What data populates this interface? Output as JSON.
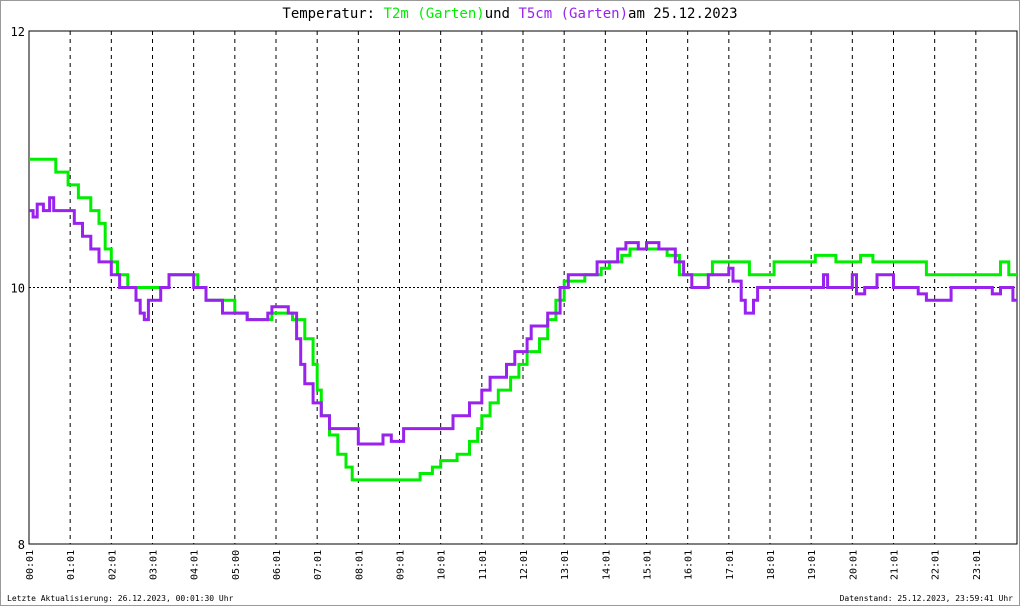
{
  "chart_data": {
    "type": "line",
    "title": {
      "prefix": "Temperatur:",
      "s1": "T2m (Garten)",
      "mid": "und",
      "s2": "T5cm (Garten)",
      "suffix": "am 25.12.2023"
    },
    "ylim": [
      8,
      12
    ],
    "yticks": [
      "8",
      "10",
      "12"
    ],
    "xticks": [
      "00:01",
      "01:01",
      "02:01",
      "03:01",
      "04:01",
      "05:00",
      "06:01",
      "07:01",
      "08:01",
      "09:01",
      "10:01",
      "11:01",
      "12:01",
      "13:01",
      "14:01",
      "15:01",
      "16:01",
      "17:01",
      "18:01",
      "19:01",
      "20:01",
      "21:01",
      "22:01",
      "23:01"
    ],
    "xunit": "hours",
    "series": [
      {
        "name": "T2m (Garten)",
        "color": "#00ee00",
        "points": [
          [
            0,
            11.0
          ],
          [
            0.65,
            10.9
          ],
          [
            0.95,
            10.8
          ],
          [
            1.2,
            10.7
          ],
          [
            1.5,
            10.6
          ],
          [
            1.7,
            10.5
          ],
          [
            1.85,
            10.3
          ],
          [
            2.0,
            10.2
          ],
          [
            2.15,
            10.1
          ],
          [
            2.4,
            10.0
          ],
          [
            3.4,
            10.1
          ],
          [
            4.1,
            10.0
          ],
          [
            4.3,
            9.9
          ],
          [
            5.0,
            9.8
          ],
          [
            5.3,
            9.75
          ],
          [
            5.9,
            9.8
          ],
          [
            6.4,
            9.75
          ],
          [
            6.7,
            9.6
          ],
          [
            6.9,
            9.4
          ],
          [
            7.0,
            9.2
          ],
          [
            7.1,
            9.0
          ],
          [
            7.3,
            8.85
          ],
          [
            7.5,
            8.7
          ],
          [
            7.7,
            8.6
          ],
          [
            7.85,
            8.5
          ],
          [
            9.5,
            8.55
          ],
          [
            9.8,
            8.6
          ],
          [
            10.0,
            8.65
          ],
          [
            10.4,
            8.7
          ],
          [
            10.7,
            8.8
          ],
          [
            10.9,
            8.9
          ],
          [
            11.0,
            9.0
          ],
          [
            11.2,
            9.1
          ],
          [
            11.4,
            9.2
          ],
          [
            11.7,
            9.3
          ],
          [
            11.9,
            9.4
          ],
          [
            12.1,
            9.5
          ],
          [
            12.4,
            9.6
          ],
          [
            12.6,
            9.75
          ],
          [
            12.8,
            9.9
          ],
          [
            13.0,
            10.05
          ],
          [
            13.5,
            10.1
          ],
          [
            13.9,
            10.15
          ],
          [
            14.1,
            10.2
          ],
          [
            14.4,
            10.25
          ],
          [
            14.6,
            10.3
          ],
          [
            15.5,
            10.25
          ],
          [
            15.8,
            10.1
          ],
          [
            16.6,
            10.2
          ],
          [
            17.5,
            10.1
          ],
          [
            18.1,
            10.2
          ],
          [
            19.1,
            10.25
          ],
          [
            19.6,
            10.2
          ],
          [
            20.2,
            10.25
          ],
          [
            20.5,
            10.2
          ],
          [
            21.8,
            10.1
          ],
          [
            23.6,
            10.2
          ],
          [
            23.8,
            10.1
          ],
          [
            24,
            10.1
          ]
        ]
      },
      {
        "name": "T5cm (Garten)",
        "color": "#9922ee",
        "points": [
          [
            0,
            10.6
          ],
          [
            0.1,
            10.55
          ],
          [
            0.2,
            10.65
          ],
          [
            0.35,
            10.6
          ],
          [
            0.5,
            10.7
          ],
          [
            0.6,
            10.6
          ],
          [
            0.95,
            10.6
          ],
          [
            1.1,
            10.5
          ],
          [
            1.3,
            10.4
          ],
          [
            1.5,
            10.3
          ],
          [
            1.7,
            10.2
          ],
          [
            2.0,
            10.1
          ],
          [
            2.2,
            10.0
          ],
          [
            2.6,
            9.9
          ],
          [
            2.7,
            9.8
          ],
          [
            2.8,
            9.75
          ],
          [
            2.9,
            9.9
          ],
          [
            3.2,
            10.0
          ],
          [
            3.4,
            10.1
          ],
          [
            4.0,
            10.0
          ],
          [
            4.3,
            9.9
          ],
          [
            4.7,
            9.8
          ],
          [
            5.3,
            9.75
          ],
          [
            5.8,
            9.8
          ],
          [
            5.9,
            9.85
          ],
          [
            6.3,
            9.8
          ],
          [
            6.5,
            9.6
          ],
          [
            6.6,
            9.4
          ],
          [
            6.7,
            9.25
          ],
          [
            6.9,
            9.1
          ],
          [
            7.1,
            9.0
          ],
          [
            7.3,
            8.9
          ],
          [
            8.0,
            8.78
          ],
          [
            8.6,
            8.85
          ],
          [
            8.8,
            8.8
          ],
          [
            9.1,
            8.9
          ],
          [
            10.3,
            9.0
          ],
          [
            10.7,
            9.1
          ],
          [
            11.0,
            9.2
          ],
          [
            11.2,
            9.3
          ],
          [
            11.6,
            9.4
          ],
          [
            11.8,
            9.5
          ],
          [
            12.1,
            9.6
          ],
          [
            12.2,
            9.7
          ],
          [
            12.6,
            9.8
          ],
          [
            12.9,
            10.0
          ],
          [
            13.1,
            10.1
          ],
          [
            13.8,
            10.2
          ],
          [
            14.3,
            10.3
          ],
          [
            14.5,
            10.35
          ],
          [
            14.8,
            10.3
          ],
          [
            15.0,
            10.35
          ],
          [
            15.3,
            10.3
          ],
          [
            15.7,
            10.2
          ],
          [
            15.9,
            10.1
          ],
          [
            16.1,
            10.0
          ],
          [
            16.5,
            10.1
          ],
          [
            17.0,
            10.15
          ],
          [
            17.1,
            10.05
          ],
          [
            17.3,
            9.9
          ],
          [
            17.4,
            9.8
          ],
          [
            17.6,
            9.9
          ],
          [
            17.7,
            10.0
          ],
          [
            19.3,
            10.1
          ],
          [
            19.4,
            10.0
          ],
          [
            20.0,
            10.1
          ],
          [
            20.1,
            9.95
          ],
          [
            20.3,
            10.0
          ],
          [
            20.6,
            10.1
          ],
          [
            21.0,
            10.0
          ],
          [
            21.6,
            9.95
          ],
          [
            21.8,
            9.9
          ],
          [
            22.4,
            10.0
          ],
          [
            23.4,
            9.95
          ],
          [
            23.6,
            10.0
          ],
          [
            23.9,
            9.9
          ],
          [
            24,
            9.9
          ]
        ]
      }
    ]
  },
  "footer": {
    "left": "Letzte Aktualisierung: 26.12.2023, 00:01:30 Uhr",
    "right": "Datenstand: 25.12.2023, 23:59:41 Uhr"
  }
}
